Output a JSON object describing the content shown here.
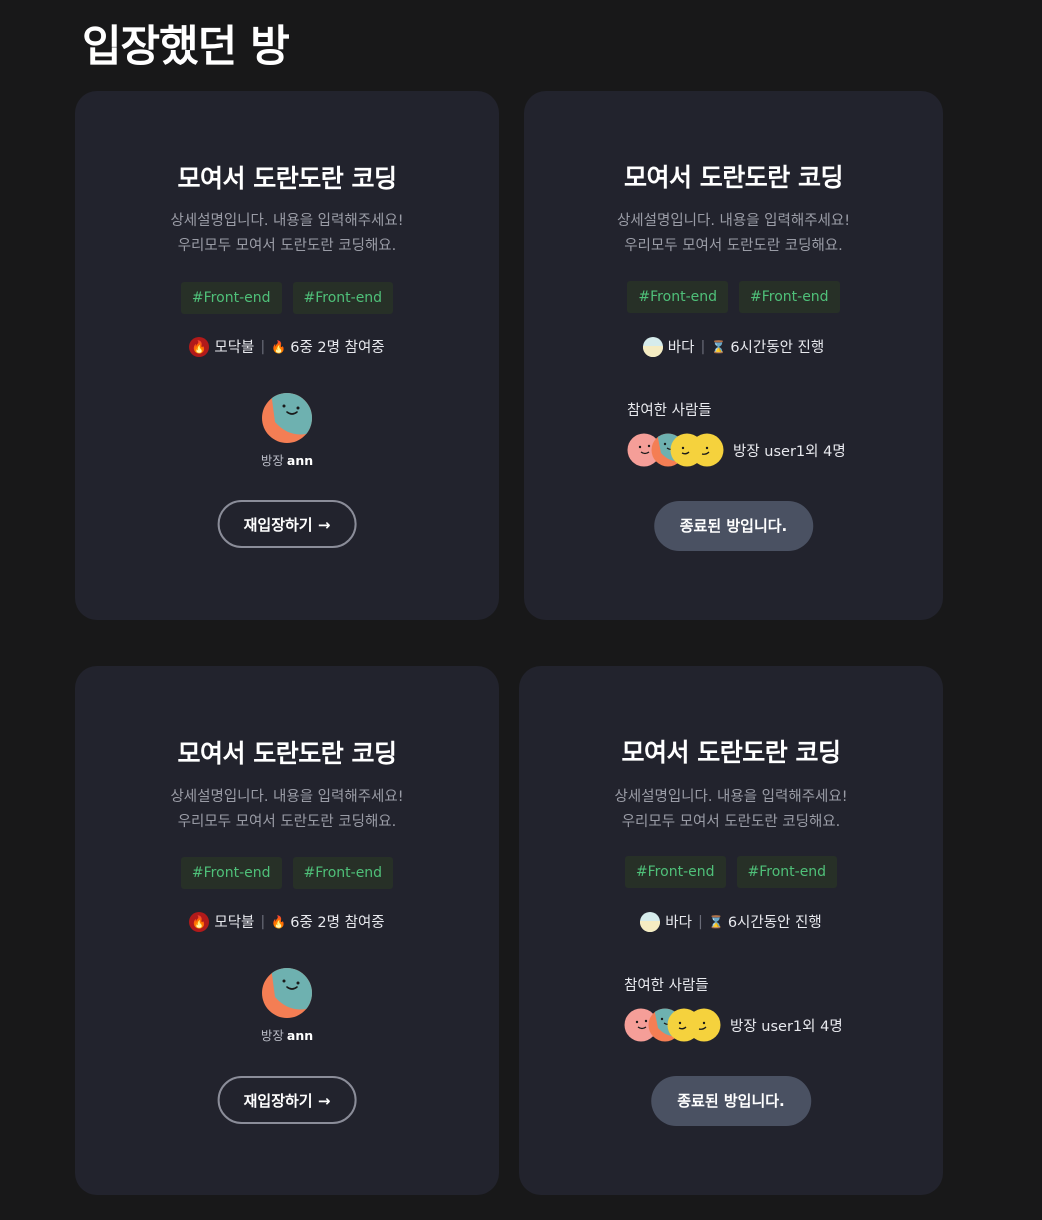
{
  "page": {
    "title": "입장했던 방"
  },
  "rooms": [
    {
      "title": "모여서 도란도란 코딩",
      "desc_line1": "상세설명입니다. 내용을 입력해주세요!",
      "desc_line2": "우리모두 모여서 도란도란 코딩해요.",
      "tags": [
        "#Front-end",
        "#Front-end"
      ],
      "category": "모닥불",
      "status_text": "6중 2명 참여중",
      "host_prefix": "방장",
      "host_name": "ann",
      "action_label": "재입장하기 →"
    },
    {
      "title": "모여서 도란도란 코딩",
      "desc_line1": "상세설명입니다. 내용을 입력해주세요!",
      "desc_line2": "우리모두 모여서 도란도란 코딩해요.",
      "tags": [
        "#Front-end",
        "#Front-end"
      ],
      "category": "바다",
      "status_text": "6시간동안 진행",
      "participants_label": "참여한 사람들",
      "participants_summary": "방장 user1외 4명",
      "action_label": "종료된 방입니다."
    },
    {
      "title": "모여서 도란도란 코딩",
      "desc_line1": "상세설명입니다. 내용을 입력해주세요!",
      "desc_line2": "우리모두 모여서 도란도란 코딩해요.",
      "tags": [
        "#Front-end",
        "#Front-end"
      ],
      "category": "모닥불",
      "status_text": "6중 2명 참여중",
      "host_prefix": "방장",
      "host_name": "ann",
      "action_label": "재입장하기 →"
    },
    {
      "title": "모여서 도란도란 코딩",
      "desc_line1": "상세설명입니다. 내용을 입력해주세요!",
      "desc_line2": "우리모두 모여서 도란도란 코딩해요.",
      "tags": [
        "#Front-end",
        "#Front-end"
      ],
      "category": "바다",
      "status_text": "6시간동안 진행",
      "participants_label": "참여한 사람들",
      "participants_summary": "방장 user1외 4명",
      "action_label": "종료된 방입니다."
    }
  ],
  "icons": {
    "category_active": "campfire-icon",
    "category_ended": "sea-icon",
    "status_active": "fire-icon",
    "status_ended": "hourglass-icon"
  },
  "colors": {
    "background": "#181819",
    "card": "#22232d",
    "tag_text": "#4fc079",
    "tag_bg": "#273027",
    "ended_button": "#4a5162",
    "avatar_teal": "#6eb1b0",
    "avatar_orange": "#f47e54",
    "avatar_pink": "#f59e98",
    "avatar_yellow": "#f5d23d"
  }
}
